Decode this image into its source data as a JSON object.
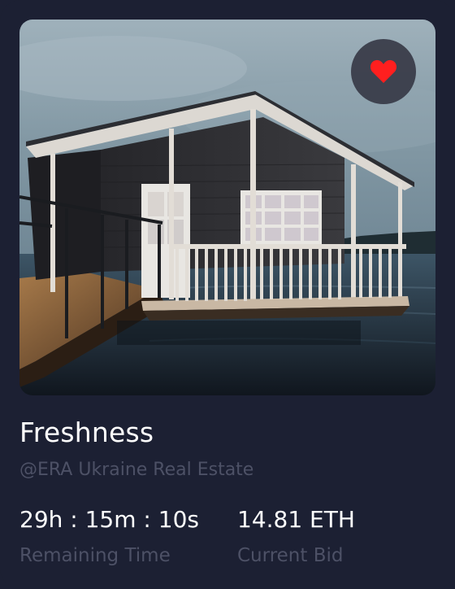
{
  "card": {
    "title": "Freshness",
    "owner": "@ERA Ukraine Real Estate",
    "favorite": {
      "icon": "heart-icon",
      "active": true,
      "color": "#ff1f1f"
    }
  },
  "stats": {
    "time_value": "29h : 15m : 10s",
    "time_label": "Remaining Time",
    "bid_value": "14.81 ETH",
    "bid_label": "Current Bid"
  },
  "colors": {
    "background": "#1c2033",
    "text_primary": "#ffffff",
    "text_muted": "#4d5166"
  }
}
